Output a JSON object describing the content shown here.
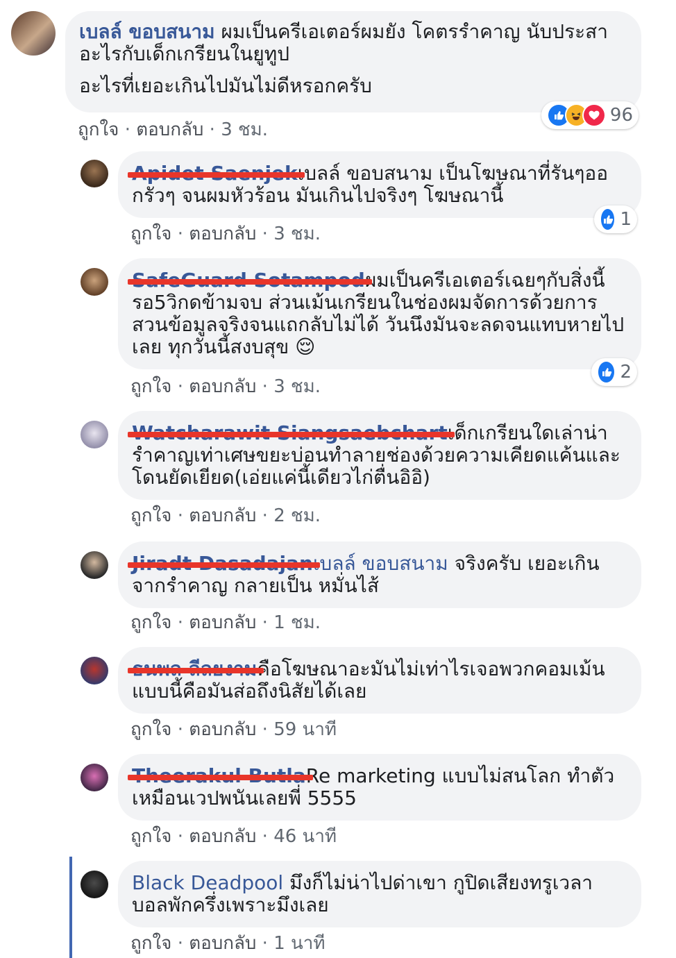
{
  "comments": [
    {
      "name": "เบลล์ ขอบสนาม",
      "name_redacted": false,
      "text": "ผมเป็นครีเอเตอร์ผมยัง โคตรรำคาญ นับประสาอะไรกับเด็กเกรียนในยูทูป",
      "text2": "อะไรที่เยอะเกินไปมันไม่ดีหรอกครับ",
      "like": "ถูกใจ",
      "reply": "ตอบกลับ",
      "time": "3 ชม.",
      "reactions": "96"
    },
    {
      "name": "Apidet Saenjek",
      "name_redacted": true,
      "text": "เบลล์ ขอบสนาม เป็นโฆษณาที่รันๆออกรัวๆ จนผมหัวร้อน มันเกินไปจริงๆ โฆษณานี้",
      "like": "ถูกใจ",
      "reply": "ตอบกลับ",
      "time": "3 ชม.",
      "reactions": "1"
    },
    {
      "name": "SafeGuard Sotampod",
      "name_redacted": true,
      "text": "ผมเป็นครีเอเตอร์เฉยๆกับสิ่งนี้ รอ5วิกดข้ามจบ ส่วนเม้นเกรียนในช่องผมจัดการด้วยการสวนข้อมูลจริงจนแถกลับไม่ได้ วันนึงมันจะลดจนแทบหายไปเลย ทุกวันนี้สงบสุข 😌",
      "like": "ถูกใจ",
      "reply": "ตอบกลับ",
      "time": "3 ชม.",
      "reactions": "2"
    },
    {
      "name": "Watcharawit Siangsaebchart",
      "name_redacted": true,
      "text": "เด็กเกรียนใดเล่าน่ารำคาญเท่าเศษขยะบ่อนทำลายช่องด้วยความเคียดแค้นและโดนยัดเยียด(เอ่ยแค่นี้เดียวไก่ตื่นอิอิ)",
      "like": "ถูกใจ",
      "reply": "ตอบกลับ",
      "time": "2 ชม."
    },
    {
      "name": "Jiradt Dasadajan",
      "name_redacted": true,
      "mention": "เบลล์ ขอบสนาม",
      "text": "จริงครับ เยอะเกินจากรำคาญ กลายเป็น หมั่นไส้",
      "like": "ถูกใจ",
      "reply": "ตอบกลับ",
      "time": "1 ชม."
    },
    {
      "name": "ธนพล ลีลยงาม",
      "name_redacted": true,
      "text": "คือโฆษณาอะมันไม่เท่าไรเจอพวกคอมเม้นแบบนี้คือมันส่อถึงนิสัยได้เลย",
      "like": "ถูกใจ",
      "reply": "ตอบกลับ",
      "time": "59 นาที"
    },
    {
      "name": "Theerakul Butla",
      "name_redacted": true,
      "text": "Re marketing แบบไม่สนโลก ทำตัวเหมือนเวปพนันเลยพี่ 5555",
      "like": "ถูกใจ",
      "reply": "ตอบกลับ",
      "time": "46 นาที"
    },
    {
      "name": "Black Deadpool",
      "name_redacted": false,
      "text": "มึงก็ไม่น่าไปด่าเขา กูปิดเสียงทรูเวลาบอลพักครึ่งเพราะมึงเลย",
      "like": "ถูกใจ",
      "reply": "ตอบกลับ",
      "time": "1 นาที"
    }
  ],
  "separator": "·",
  "icons": {
    "like": "thumbs-up-icon",
    "haha": "laughing-face-icon",
    "love": "heart-icon"
  },
  "colors": {
    "name": "#385898",
    "bubble": "#f2f3f5",
    "redaction": "#e8352a",
    "accent": "#4267b2"
  }
}
